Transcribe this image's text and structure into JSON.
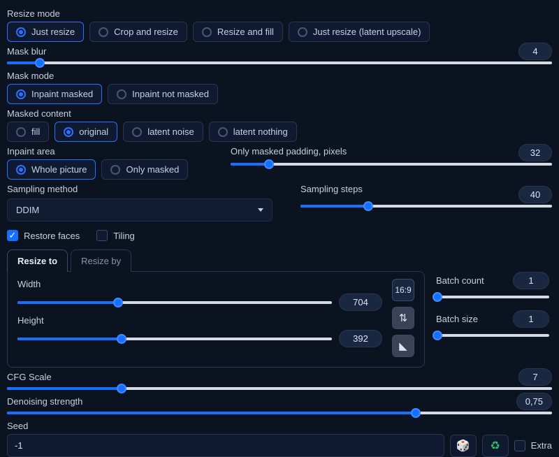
{
  "resize_mode": {
    "label": "Resize mode",
    "options": [
      "Just resize",
      "Crop and resize",
      "Resize and fill",
      "Just resize (latent upscale)"
    ],
    "selected": 0
  },
  "mask_blur": {
    "label": "Mask blur",
    "value": 4,
    "min": 0,
    "max": 64,
    "pct": 6
  },
  "mask_mode": {
    "label": "Mask mode",
    "options": [
      "Inpaint masked",
      "Inpaint not masked"
    ],
    "selected": 0
  },
  "masked_content": {
    "label": "Masked content",
    "options": [
      "fill",
      "original",
      "latent noise",
      "latent nothing"
    ],
    "selected": 1
  },
  "inpaint_area": {
    "label": "Inpaint area",
    "options": [
      "Whole picture",
      "Only masked"
    ],
    "selected": 0
  },
  "only_masked_padding": {
    "label": "Only masked padding, pixels",
    "value": 32,
    "min": 0,
    "max": 256,
    "pct": 12
  },
  "sampling_method": {
    "label": "Sampling method",
    "value": "DDIM"
  },
  "sampling_steps": {
    "label": "Sampling steps",
    "value": 40,
    "min": 1,
    "max": 150,
    "pct": 27
  },
  "restore_faces": {
    "label": "Restore faces",
    "checked": true
  },
  "tiling": {
    "label": "Tiling",
    "checked": false
  },
  "tabs": {
    "resize_to": "Resize to",
    "resize_by": "Resize by",
    "active": 0
  },
  "width": {
    "label": "Width",
    "value": 704,
    "min": 64,
    "max": 2048,
    "pct": 32
  },
  "height": {
    "label": "Height",
    "value": 392,
    "min": 64,
    "max": 2048,
    "pct": 33
  },
  "aspect_label": "16:9",
  "batch_count": {
    "label": "Batch count",
    "value": 1,
    "min": 1,
    "max": 100,
    "pct": 1
  },
  "batch_size": {
    "label": "Batch size",
    "value": 1,
    "min": 1,
    "max": 8,
    "pct": 1
  },
  "cfg_scale": {
    "label": "CFG Scale",
    "value": 7,
    "min": 1,
    "max": 30,
    "pct": 21
  },
  "denoising": {
    "label": "Denoising strength",
    "value": "0,75",
    "min": 0,
    "max": 1,
    "pct": 75
  },
  "seed": {
    "label": "Seed",
    "value": "-1",
    "extra_label": "Extra"
  }
}
